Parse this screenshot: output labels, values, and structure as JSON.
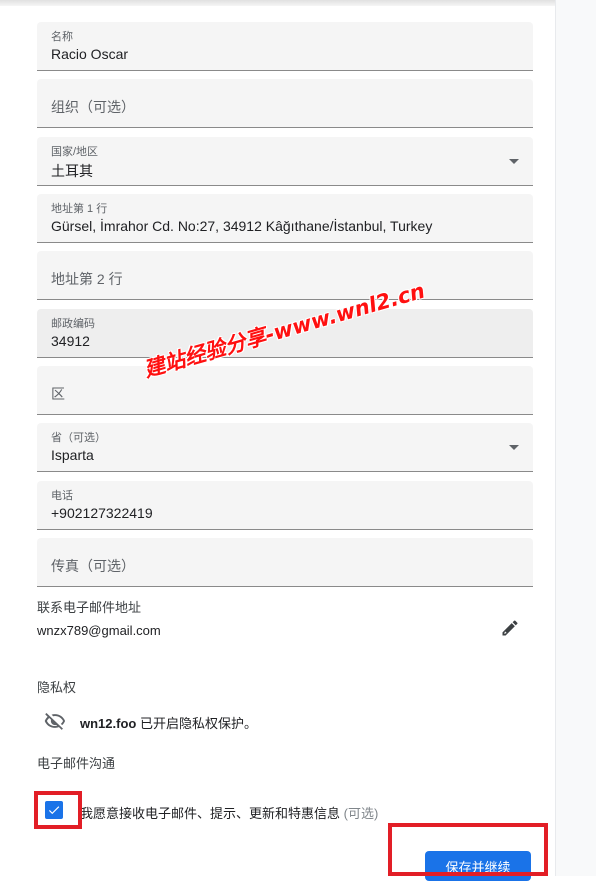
{
  "form": {
    "name": {
      "label": "名称",
      "value": "Racio Oscar"
    },
    "organization": {
      "placeholder": "组织（可选）"
    },
    "country": {
      "label": "国家/地区",
      "value": "土耳其"
    },
    "address_line1": {
      "label": "地址第 1 行",
      "value": "Gürsel, İmrahor Cd. No:27, 34912 Kâğıthane/İstanbul, Turkey"
    },
    "address_line2": {
      "placeholder": "地址第 2 行"
    },
    "postal_code": {
      "label": "邮政编码",
      "value": "34912"
    },
    "district": {
      "placeholder": "区"
    },
    "province": {
      "label": "省（可选）",
      "value": "Isparta"
    },
    "phone": {
      "label": "电话",
      "value": "+902127322419"
    },
    "fax": {
      "placeholder": "传真（可选）"
    }
  },
  "contact_email": {
    "label": "联系电子邮件地址",
    "value": "wnzx789@gmail.com",
    "edit_icon": "pencil-icon"
  },
  "privacy": {
    "heading": "隐私权",
    "icon": "eye-off-icon",
    "domain": "wn12.foo",
    "text": " 已开启隐私权保护。"
  },
  "email_comms": {
    "heading": "电子邮件沟通",
    "checked": true,
    "consent": "我愿意接收电子邮件、提示、更新和特惠信息",
    "optional": " (可选)"
  },
  "actions": {
    "save_label": "保存并继续"
  },
  "watermark": "建站经验分享-www.wnl2.cn",
  "colors": {
    "accent": "#1a73e8",
    "highlight": "#e21e26"
  }
}
